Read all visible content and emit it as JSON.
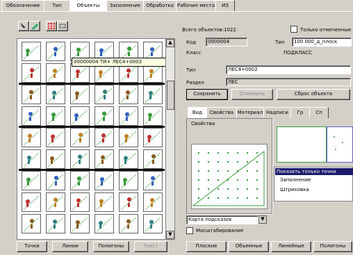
{
  "tabs": [
    "Обозначение",
    "Тип",
    "Объекты",
    "Заполнение",
    "Обработка",
    "Рабочие места",
    "ИЗ"
  ],
  "active_tab": 2,
  "toolbar": {
    "icons": [
      "pointer-icon",
      "pencil-icon",
      "grid-icon",
      "eraser-icon"
    ]
  },
  "header": {
    "count_label": "Всего объектов:",
    "count_value": "1022",
    "checkbox_label": "Только отмеченные"
  },
  "info": {
    "code_label": "Код",
    "code_value": "0000004",
    "type_label": "Тип",
    "type_value": "100 000_д_плоск",
    "class_label": "Класс",
    "class_value": "ПОДКЛАСС",
    "name_label": "Тип",
    "name_value": "ЛЕС4+0002",
    "section_label": "Раздел",
    "section_value": "ЛЕС"
  },
  "tooltip": "00000004  ТИ+ ЛЕС4+0002",
  "buttons": {
    "save": "Сохранить",
    "cancel": "Отменить",
    "reset": "Сброс объекта",
    "bottom_left": [
      "Точки",
      "Линии",
      "Полигоны",
      "Текст"
    ],
    "bottom_right": [
      "Плоские",
      "Объемные",
      "Линейные",
      "Полигоны"
    ]
  },
  "inner_tabs": [
    "Вид",
    "Свойства",
    "Материал",
    "Надписи",
    "Гр",
    "Сп"
  ],
  "preview_title": "Свойства",
  "style_options": [
    "Показать только точки",
    "Заполнение",
    "Штриховка"
  ],
  "dropdown_value": "Карта подсказок",
  "frame_checkbox": "Масштабирование",
  "scroll_up_icon": "scroll-up-arrow-icon",
  "scroll_down_icon": "scroll-down-arrow-icon"
}
